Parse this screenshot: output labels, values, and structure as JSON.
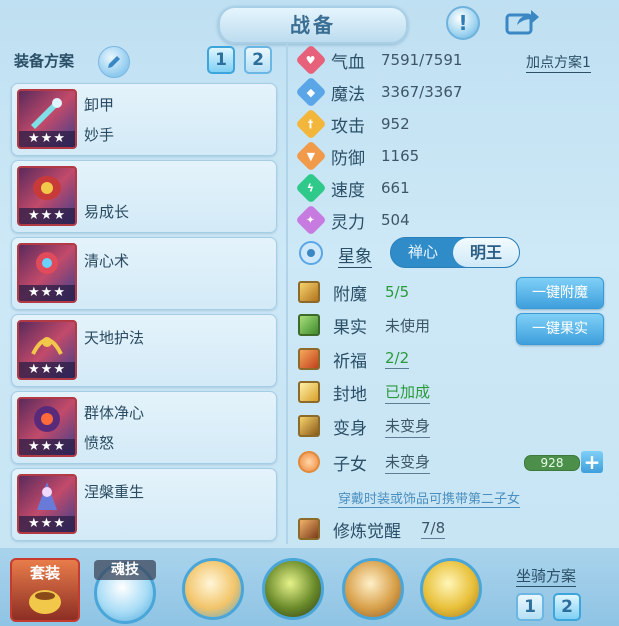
{
  "header": {
    "title": "战备",
    "warn_icon_text": "!"
  },
  "left": {
    "plan_label": "装备方案",
    "plan_tabs": [
      "1",
      "2"
    ],
    "cards": [
      {
        "line1": "卸甲",
        "line2": "妙手",
        "stars": "★★★"
      },
      {
        "line1": "",
        "line2": "易成长",
        "stars": "★★★"
      },
      {
        "line1": "清心术",
        "line2": "",
        "stars": "★★★"
      },
      {
        "line1": "天地护法",
        "line2": "",
        "stars": "★★★"
      },
      {
        "line1": "群体净心",
        "line2": "愤怒",
        "stars": "★★★"
      },
      {
        "line1": "涅槃重生",
        "line2": "",
        "stars": "★★★"
      }
    ]
  },
  "stats": {
    "plan_link": "加点方案1",
    "rows": [
      {
        "name": "气血",
        "value": "7591/7591",
        "color": "#e8617a"
      },
      {
        "name": "魔法",
        "value": "3367/3367",
        "color": "#5aa6e6"
      },
      {
        "name": "攻击",
        "value": "952",
        "color": "#f2b73a"
      },
      {
        "name": "防御",
        "value": "1165",
        "color": "#f09a4a"
      },
      {
        "name": "速度",
        "value": "661",
        "color": "#2fc98a"
      },
      {
        "name": "灵力",
        "value": "504",
        "color": "#c77be0"
      }
    ],
    "star_label": "星象",
    "star_options": [
      "禅心",
      "明王"
    ]
  },
  "items": [
    {
      "name": "附魔",
      "value": "5/5",
      "style": "green",
      "underline": false
    },
    {
      "name": "果实",
      "value": "未使用",
      "style": "grey",
      "underline": false
    },
    {
      "name": "祈福",
      "value": "2/2",
      "style": "green",
      "underline": true
    },
    {
      "name": "封地",
      "value": "已加成",
      "style": "green",
      "underline": true
    },
    {
      "name": "变身",
      "value": "未变身",
      "style": "grey",
      "underline": true
    },
    {
      "name": "子女",
      "value": "未变身",
      "style": "grey",
      "underline": true
    }
  ],
  "buttons": {
    "enchant": "一键附魔",
    "fruit": "一键果实"
  },
  "child_bar_value": "928",
  "hint": "穿戴时装或饰品可携带第二子女",
  "cultivation": {
    "name": "修炼觉醒",
    "value": "7/8"
  },
  "bottom": {
    "suit_label": "套装",
    "skill_label": "魂技",
    "mount_label": "坐骑方案",
    "mount_tabs": [
      "1",
      "2"
    ]
  }
}
